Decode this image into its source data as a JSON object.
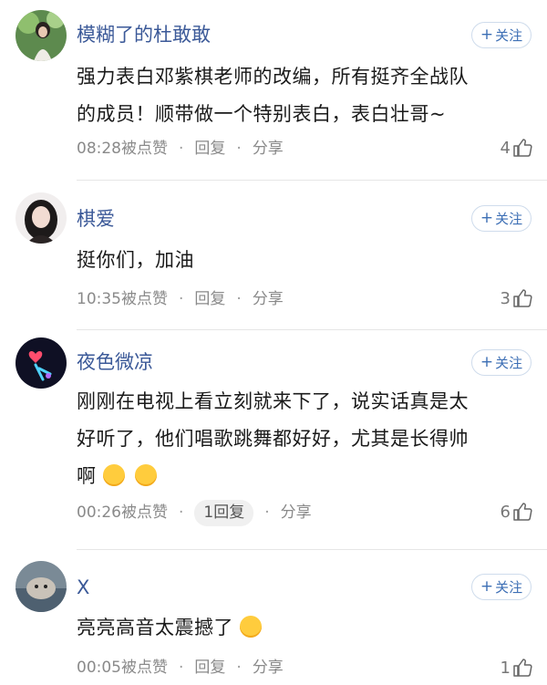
{
  "follow_label": "关注",
  "comments": [
    {
      "username": "模糊了的杜敢敢",
      "lines": [
        "强力表白邓紫棋老师的改编，所有挺齐全战队",
        "的成员！顺带做一个特别表白，表白壮哥~"
      ],
      "time": "08:28",
      "liked_label": "被点赞",
      "reply": "回复",
      "share": "分享",
      "likes": "4"
    },
    {
      "username": "棋爱",
      "lines": [
        "挺你们，加油"
      ],
      "time": "10:35",
      "liked_label": "被点赞",
      "reply": "回复",
      "share": "分享",
      "likes": "3"
    },
    {
      "username": "夜色微凉",
      "lines": [
        "刚刚在电视上看立刻就来下了，说实话真是太",
        "好听了，他们唱歌跳舞都好好，尤其是长得帅",
        "啊"
      ],
      "time": "00:26",
      "liked_label": "被点赞",
      "reply": "1回复",
      "share": "分享",
      "likes": "6"
    },
    {
      "username": "X",
      "lines": [
        "亮亮高音太震撼了"
      ],
      "time": "00:05",
      "liked_label": "被点赞",
      "reply": "回复",
      "share": "分享",
      "likes": "1"
    }
  ],
  "colors": {
    "username": "#3b5998",
    "follow_border": "#cfdcec",
    "meta": "#8a8a8a"
  },
  "icons": {
    "like": "thumbs-up-icon",
    "follow": "plus-icon",
    "emoji_smile": "smiling-face-emoji",
    "emoji_laugh": "tears-of-joy-emoji"
  }
}
